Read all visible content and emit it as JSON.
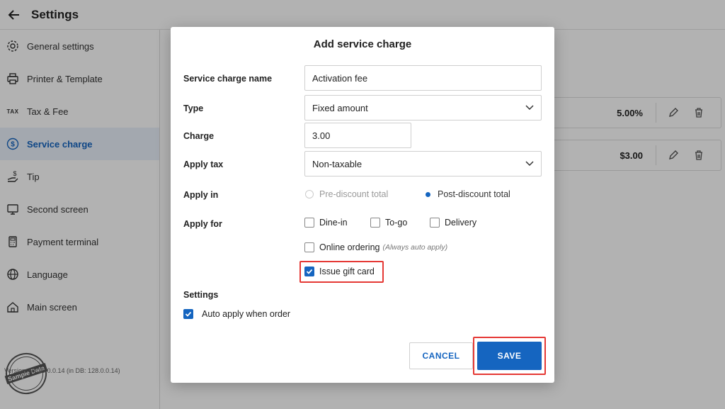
{
  "header": {
    "title": "Settings",
    "back_icon": "arrow-left-icon"
  },
  "sidebar": {
    "items": [
      {
        "label": "General settings",
        "icon": "gear-icon"
      },
      {
        "label": "Printer & Template",
        "icon": "printer-icon"
      },
      {
        "label": "Tax & Fee",
        "icon": "tax-icon",
        "icon_text": "TAX"
      },
      {
        "label": "Service charge",
        "icon": "dollar-circle-icon",
        "active": true
      },
      {
        "label": "Tip",
        "icon": "tip-hand-icon"
      },
      {
        "label": "Second screen",
        "icon": "monitor-icon"
      },
      {
        "label": "Payment terminal",
        "icon": "terminal-icon"
      },
      {
        "label": "Language",
        "icon": "globe-icon"
      },
      {
        "label": "Main screen",
        "icon": "home-icon"
      }
    ],
    "stamp": "Sample Data",
    "version": "Version:  RC20.0.0.14 (in DB: 128.0.0.14)"
  },
  "list": {
    "rows": [
      {
        "value": "5.00%"
      },
      {
        "value": "$3.00"
      }
    ]
  },
  "modal": {
    "title": "Add service charge",
    "name": {
      "label": "Service charge name",
      "value": "Activation fee"
    },
    "type": {
      "label": "Type",
      "value": "Fixed amount"
    },
    "charge": {
      "label": "Charge",
      "value": "3.00"
    },
    "apply_tax": {
      "label": "Apply tax",
      "value": "Non-taxable"
    },
    "apply_in": {
      "label": "Apply in",
      "options": [
        "Pre-discount total",
        "Post-discount total"
      ],
      "selected": "Post-discount total"
    },
    "apply_for": {
      "label": "Apply for",
      "dine_in": "Dine-in",
      "to_go": "To-go",
      "delivery": "Delivery",
      "online": "Online ordering",
      "online_hint": "(Always auto apply)",
      "gift_card": "Issue gift card",
      "gift_card_checked": true
    },
    "settings": {
      "label": "Settings",
      "auto_apply": "Auto apply when order",
      "auto_apply_checked": true
    },
    "cancel_label": "CANCEL",
    "save_label": "SAVE"
  },
  "colors": {
    "accent": "#1565c0",
    "highlight": "#e53935"
  }
}
